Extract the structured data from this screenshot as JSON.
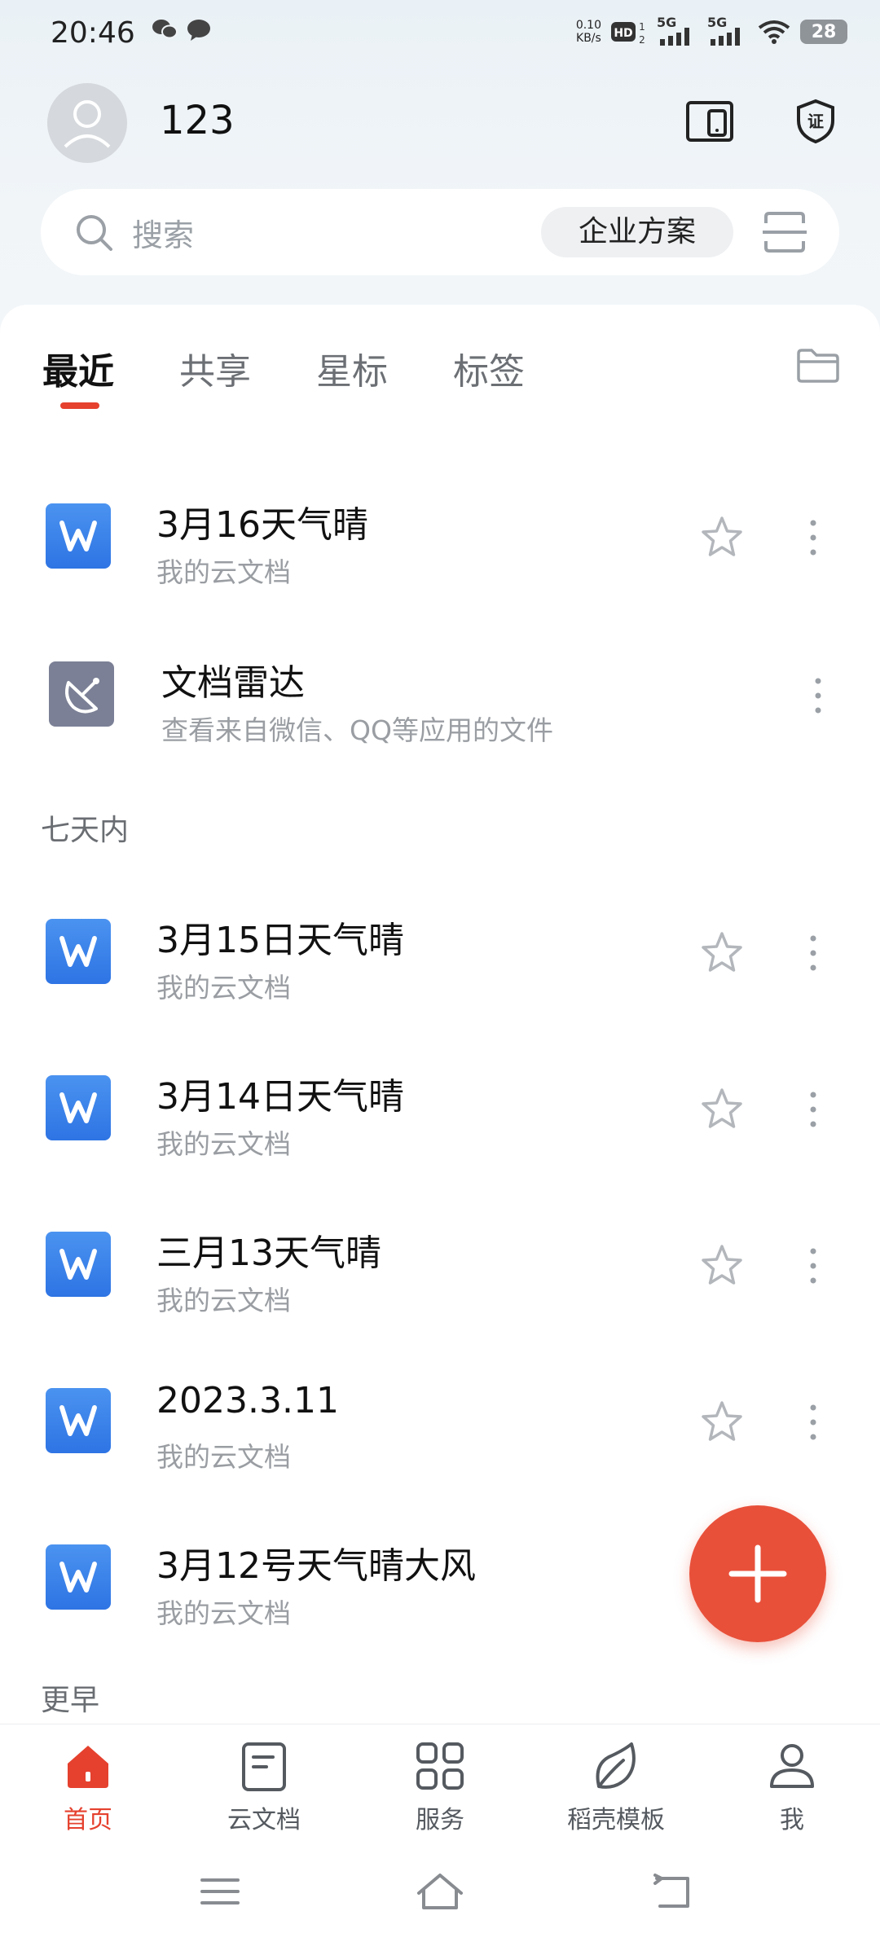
{
  "status_bar": {
    "time": "20:46",
    "speed_value": "0.10",
    "speed_unit": "KB/s",
    "network_1": "5G",
    "network_2": "5G",
    "battery": "28"
  },
  "header": {
    "username": "123"
  },
  "search": {
    "placeholder": "搜索",
    "enterprise_label": "企业方案"
  },
  "tabs": [
    {
      "label": "最近"
    },
    {
      "label": "共享"
    },
    {
      "label": "星标"
    },
    {
      "label": "标签"
    }
  ],
  "pinned": [
    {
      "title": "3月16天气晴",
      "subtitle": "我的云文档"
    },
    {
      "title": "文档雷达",
      "subtitle": "查看来自微信、QQ等应用的文件"
    }
  ],
  "sections": {
    "week_label": "七天内",
    "earlier_label": "更早"
  },
  "week_docs": [
    {
      "title": "3月15日天气晴",
      "subtitle": "我的云文档"
    },
    {
      "title": "3月14日天气晴",
      "subtitle": "我的云文档"
    },
    {
      "title": "三月13天气晴",
      "subtitle": "我的云文档"
    },
    {
      "title": "2023.3.11",
      "subtitle": "我的云文档"
    },
    {
      "title": "3月12号天气晴大风",
      "subtitle": "我的云文档"
    }
  ],
  "bottom_nav": [
    {
      "label": "首页"
    },
    {
      "label": "云文档"
    },
    {
      "label": "服务"
    },
    {
      "label": "稻壳模板"
    },
    {
      "label": "我"
    }
  ],
  "colors": {
    "accent": "#e5412e",
    "doc_blue": "#2e74e4",
    "fab": "#e8503a"
  }
}
